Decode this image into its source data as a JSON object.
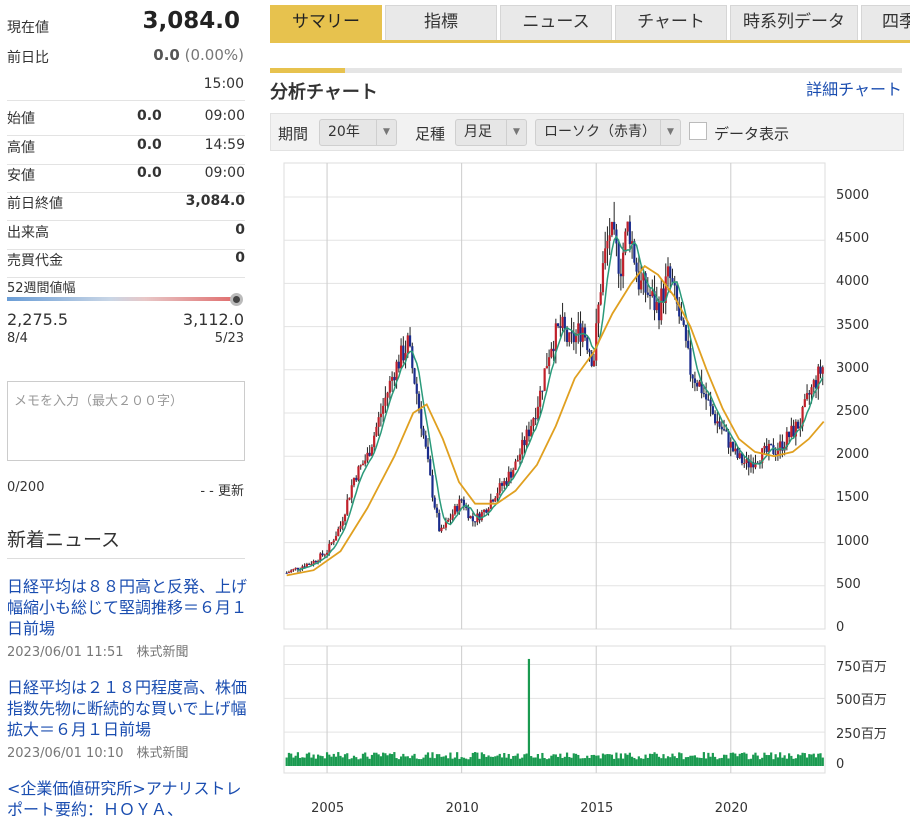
{
  "quote": {
    "price_label": "現在値",
    "price": "3,084.0",
    "change_label": "前日比",
    "change": "0.0",
    "change_pct": "(0.00%)",
    "time": "15:00",
    "rows": [
      {
        "label": "始値",
        "value": "0.0",
        "time": "09:00"
      },
      {
        "label": "高値",
        "value": "0.0",
        "time": "14:59"
      },
      {
        "label": "安値",
        "value": "0.0",
        "time": "09:00"
      },
      {
        "label": "前日終値",
        "value": "3,084.0",
        "time": ""
      },
      {
        "label": "出来高",
        "value": "0",
        "time": ""
      },
      {
        "label": "売買代金",
        "value": "0",
        "time": ""
      }
    ],
    "range_label": "52週間値幅",
    "range_low": "2,275.5",
    "range_high": "3,112.0",
    "range_low_date": "8/4",
    "range_high_date": "5/23",
    "range_position": 1.0
  },
  "memo": {
    "placeholder": "メモを入力（最大２００字）",
    "count": "0/200",
    "update": "- - 更新"
  },
  "news": {
    "heading": "新着ニュース",
    "items": [
      {
        "title": "日経平均は８８円高と反発、上げ幅縮小も総じて堅調推移＝６月１日前場",
        "date": "2023/06/01 11:51",
        "source": "株式新聞"
      },
      {
        "title": "日経平均は２１８円程度高、株価指数先物に断続的な買いで上げ幅拡大＝６月１日前場",
        "date": "2023/06/01 10:10",
        "source": "株式新聞"
      },
      {
        "title": "<企業価値研究所>アナリストレポート要約：ＨＯＹＡ、",
        "date": "",
        "source": ""
      }
    ]
  },
  "tabs": [
    "サマリー",
    "指標",
    "ニュース",
    "チャート",
    "時系列データ",
    "四季"
  ],
  "section": {
    "title": "分析チャート",
    "detail_link": "詳細チャート"
  },
  "controls": {
    "period_label": "期間",
    "period_value": "20年",
    "type_label": "足種",
    "type_value": "月足",
    "candle_value": "ローソク（赤青）",
    "data_toggle_label": "データ表示"
  },
  "colors": {
    "accent": "#e7c24e",
    "up": "#c0202a",
    "down": "#1a2c8c",
    "ma_short": "#2a9a7a",
    "ma_long": "#e0a020",
    "volume": "#1a9a50"
  },
  "chart_data": {
    "type": "candlestick",
    "price_ticks": [
      0,
      500,
      1000,
      1500,
      2000,
      2500,
      3000,
      3500,
      4000,
      4500,
      5000
    ],
    "volume_ticks": [
      "0",
      "250百万",
      "500百万",
      "750百万"
    ],
    "x_ticks": [
      "2005",
      "2010",
      "2015",
      "2020"
    ],
    "price_range": [
      0,
      5000
    ],
    "volume_range": [
      0,
      850
    ],
    "x_range": [
      2003.4,
      2023.5
    ],
    "close_path": [
      [
        2003.5,
        650
      ],
      [
        2004.0,
        720
      ],
      [
        2004.5,
        780
      ],
      [
        2005.0,
        900
      ],
      [
        2005.5,
        1200
      ],
      [
        2006.0,
        1750
      ],
      [
        2006.5,
        2000
      ],
      [
        2007.0,
        2500
      ],
      [
        2007.5,
        3000
      ],
      [
        2008.0,
        3300
      ],
      [
        2008.3,
        2800
      ],
      [
        2008.6,
        2200
      ],
      [
        2008.9,
        1600
      ],
      [
        2009.2,
        1100
      ],
      [
        2009.6,
        1300
      ],
      [
        2010.0,
        1500
      ],
      [
        2010.4,
        1250
      ],
      [
        2010.8,
        1350
      ],
      [
        2011.2,
        1550
      ],
      [
        2011.6,
        1700
      ],
      [
        2012.0,
        1900
      ],
      [
        2012.5,
        2300
      ],
      [
        2012.9,
        2700
      ],
      [
        2013.3,
        3300
      ],
      [
        2013.7,
        3500
      ],
      [
        2014.0,
        3300
      ],
      [
        2014.5,
        3500
      ],
      [
        2014.9,
        3100
      ],
      [
        2015.2,
        4100
      ],
      [
        2015.5,
        4600
      ],
      [
        2015.9,
        4200
      ],
      [
        2016.2,
        4700
      ],
      [
        2016.6,
        4000
      ],
      [
        2016.9,
        3900
      ],
      [
        2017.3,
        3700
      ],
      [
        2017.7,
        4100
      ],
      [
        2018.1,
        3600
      ],
      [
        2018.5,
        3000
      ],
      [
        2018.9,
        2800
      ],
      [
        2019.3,
        2500
      ],
      [
        2019.7,
        2300
      ],
      [
        2020.2,
        2000
      ],
      [
        2020.6,
        1900
      ],
      [
        2021.0,
        2000
      ],
      [
        2021.4,
        2050
      ],
      [
        2021.8,
        2100
      ],
      [
        2022.2,
        2250
      ],
      [
        2022.6,
        2400
      ],
      [
        2022.9,
        2700
      ],
      [
        2023.2,
        2900
      ],
      [
        2023.45,
        3050
      ]
    ],
    "ma_long_path": [
      [
        2003.5,
        620
      ],
      [
        2004.5,
        680
      ],
      [
        2005.5,
        900
      ],
      [
        2006.5,
        1400
      ],
      [
        2007.5,
        2000
      ],
      [
        2008.2,
        2500
      ],
      [
        2008.7,
        2600
      ],
      [
        2009.3,
        2200
      ],
      [
        2009.9,
        1700
      ],
      [
        2010.5,
        1450
      ],
      [
        2011.3,
        1450
      ],
      [
        2012.0,
        1600
      ],
      [
        2012.8,
        1900
      ],
      [
        2013.5,
        2350
      ],
      [
        2014.2,
        2900
      ],
      [
        2014.9,
        3200
      ],
      [
        2015.6,
        3650
      ],
      [
        2016.3,
        4000
      ],
      [
        2016.8,
        4200
      ],
      [
        2017.3,
        4100
      ],
      [
        2017.9,
        3850
      ],
      [
        2018.5,
        3500
      ],
      [
        2019.1,
        3000
      ],
      [
        2019.7,
        2550
      ],
      [
        2020.3,
        2200
      ],
      [
        2020.9,
        2050
      ],
      [
        2021.6,
        2000
      ],
      [
        2022.3,
        2050
      ],
      [
        2022.9,
        2200
      ],
      [
        2023.45,
        2400
      ]
    ],
    "volume_spike": {
      "x": 2012.5,
      "value": 800
    },
    "volume_base": 90
  }
}
